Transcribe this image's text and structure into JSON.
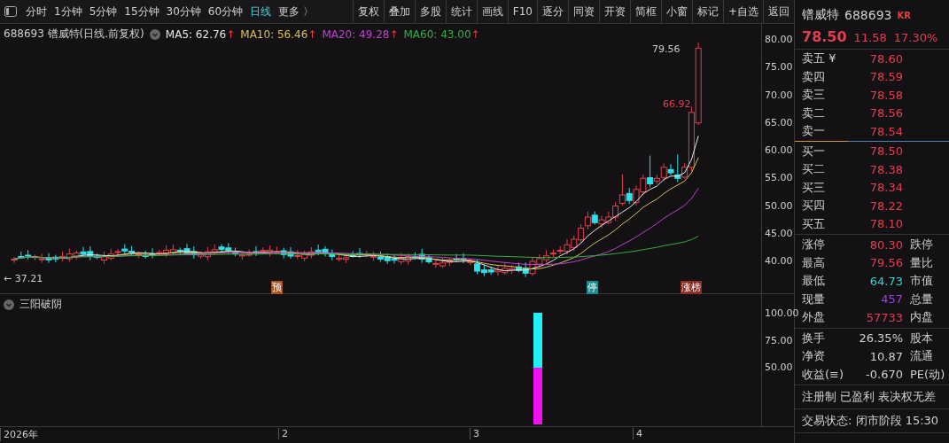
{
  "toolbar": {
    "periods": [
      {
        "label": "分时",
        "selected": false
      },
      {
        "label": "1分钟",
        "selected": false
      },
      {
        "label": "5分钟",
        "selected": false
      },
      {
        "label": "15分钟",
        "selected": false
      },
      {
        "label": "30分钟",
        "selected": false
      },
      {
        "label": "60分钟",
        "selected": false
      },
      {
        "label": "日线",
        "selected": true
      },
      {
        "label": "更多 〉",
        "selected": false
      }
    ],
    "buttons": [
      "复权",
      "叠加",
      "多股",
      "统计",
      "画线",
      "F10",
      "逐分",
      "同资",
      "开资",
      "简框",
      "小窗",
      "标记",
      "+自选",
      "返回"
    ]
  },
  "chart": {
    "title": "688693 镨威特(日线.前复权)",
    "ma": [
      {
        "label": "MA5: 62.76",
        "arrow": "↑",
        "color": "#e8e8e8"
      },
      {
        "label": "MA10: 56.46",
        "arrow": "↑",
        "color": "#d8c050"
      },
      {
        "label": "MA20: 49.28",
        "arrow": "↑",
        "color": "#c040d0"
      },
      {
        "label": "MA60: 43.00",
        "arrow": "↑",
        "color": "#30b040"
      }
    ],
    "high_label": "79.56",
    "mark_label": "66.92",
    "low_label": "← 37.21",
    "y_ticks": [
      "80.00",
      "75.00",
      "70.00",
      "65.00",
      "60.00",
      "55.00",
      "50.00",
      "45.00",
      "40.00"
    ],
    "markers": [
      {
        "label": "预",
        "color": "#a8521c"
      },
      {
        "label": "停",
        "color": "#1e8a8c"
      },
      {
        "label": "涨榜",
        "color": "#8c2a24"
      }
    ]
  },
  "indicator": {
    "title": "三阳破阴",
    "y_ticks": [
      "100.00",
      "75.00",
      "50.00"
    ]
  },
  "dates": [
    "2026年",
    "2",
    "3",
    "4"
  ],
  "quote": {
    "name": "镨威特",
    "code": "688693",
    "badge": "KR",
    "price": "78.50",
    "change": "11.58",
    "percent": "17.30%",
    "asks": [
      {
        "label": "卖五 ¥",
        "price": "78.60"
      },
      {
        "label": "卖四",
        "price": "78.59"
      },
      {
        "label": "卖三",
        "price": "78.58"
      },
      {
        "label": "卖二",
        "price": "78.56"
      },
      {
        "label": "卖一",
        "price": "78.54"
      }
    ],
    "bids": [
      {
        "label": "买一",
        "price": "78.50"
      },
      {
        "label": "买二",
        "price": "78.38"
      },
      {
        "label": "买三",
        "price": "78.34"
      },
      {
        "label": "买四",
        "price": "78.22"
      },
      {
        "label": "买五",
        "price": "78.10"
      }
    ],
    "stats": [
      {
        "label": "涨停",
        "value": "80.30",
        "color": "#e0404e",
        "label2": "跌停"
      },
      {
        "label": "最高",
        "value": "79.56",
        "color": "#e0404e",
        "label2": "量比"
      },
      {
        "label": "最低",
        "value": "64.73",
        "color": "#30d8d0",
        "label2": "市值"
      },
      {
        "label": "现量",
        "value": "457",
        "color": "#a040d8",
        "label2": "总量"
      },
      {
        "label": "外盘",
        "value": "57733",
        "color": "#e0404e",
        "label2": "内盘"
      }
    ],
    "fundamentals": [
      {
        "label": "换手",
        "value": "26.35%",
        "label2": "股本"
      },
      {
        "label": "净资",
        "value": "10.87",
        "label2": "流通"
      },
      {
        "label": "收益(≡)",
        "value": "-0.670",
        "label2": "PE(动)"
      }
    ],
    "notes": [
      "注册制 已盈利 表决权无差",
      "交易状态: 闭市阶段 15:30"
    ]
  }
}
